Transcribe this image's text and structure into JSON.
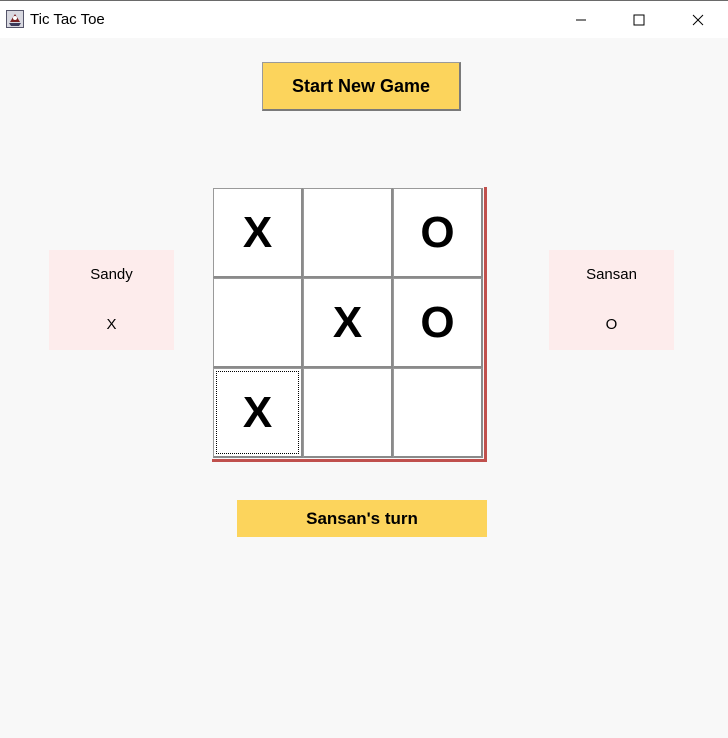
{
  "window": {
    "title": "Tic Tac Toe",
    "app_icon": "java-cup-icon",
    "controls": [
      "minimize-icon",
      "maximize-icon",
      "close-icon"
    ]
  },
  "toolbar": {
    "start_label": "Start New Game"
  },
  "players": [
    {
      "name": "Sandy",
      "mark": "X"
    },
    {
      "name": "Sansan",
      "mark": "O"
    }
  ],
  "board": {
    "cells": [
      "X",
      "",
      "O",
      "",
      "X",
      "O",
      "X",
      "",
      ""
    ]
  },
  "status": {
    "text": "Sansan's turn"
  },
  "colors": {
    "accent": "#fcd45c",
    "player_panel": "#fdecec",
    "board_border": "#c0504d",
    "background": "#f8f8f8"
  }
}
